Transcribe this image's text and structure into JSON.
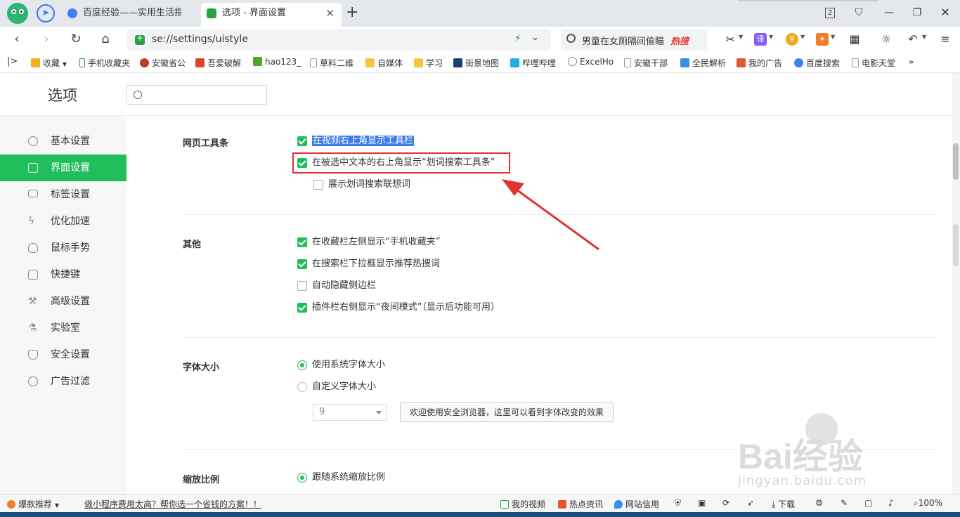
{
  "browser": {
    "tabs": [
      {
        "label": "百度经验——实用生活指南",
        "active": false
      },
      {
        "label": "选项 - 界面设置",
        "active": true
      }
    ],
    "window_count": "2",
    "address_url": "se://settings/uistyle",
    "search_text": "男童在女厕隔间偷瞄",
    "search_hot": "热搜"
  },
  "bookmarks": [
    "收藏",
    "手机收藏夹",
    "安徽省公",
    "吾爱破解",
    "hao123_",
    "草料二维",
    "自媒体",
    "学习",
    "街景地图",
    "哔哩哔哩",
    "ExcelHo",
    "安徽干部",
    "全民解析",
    "我的广告",
    "百度搜索",
    "电影天堂",
    "»"
  ],
  "page": {
    "title": "选项"
  },
  "sidebar": {
    "items": [
      {
        "label": "基本设置",
        "icon": "gear-icon"
      },
      {
        "label": "界面设置",
        "icon": "window-icon",
        "active": true
      },
      {
        "label": "标签设置",
        "icon": "tab-icon"
      },
      {
        "label": "优化加速",
        "icon": "bolt-icon"
      },
      {
        "label": "鼠标手势",
        "icon": "mouse-icon"
      },
      {
        "label": "快捷键",
        "icon": "keyboard-icon"
      },
      {
        "label": "高级设置",
        "icon": "wrench-icon"
      },
      {
        "label": "实验室",
        "icon": "flask-icon"
      },
      {
        "label": "安全设置",
        "icon": "shield-icon"
      },
      {
        "label": "广告过滤",
        "icon": "block-icon"
      }
    ]
  },
  "sections": {
    "toolbar": {
      "title": "网页工具条",
      "opt1": "在视频右上角显示工具栏",
      "opt2": "在被选中文本的右上角显示“划词搜索工具条”",
      "opt3": "展示划词搜索联想词"
    },
    "other": {
      "title": "其他",
      "opt1": "在收藏栏左侧显示“手机收藏夹”",
      "opt2": "在搜索栏下拉框显示推荐热搜词",
      "opt3": "自动隐藏侧边栏",
      "opt4": "插件栏右侧显示“夜间模式”（显示后功能可用）"
    },
    "font": {
      "title": "字体大小",
      "opt1": "使用系统字体大小",
      "opt2": "自定义字体大小",
      "size_value": "9",
      "preview": "欢迎使用安全浏览器，这里可以看到字体改变的效果"
    },
    "zoom": {
      "title": "缩放比例",
      "opt1": "跟随系统缩放比例"
    }
  },
  "watermark": {
    "brand": "Bai经验",
    "domain": "jingyan.baidu.com"
  },
  "statusbar": {
    "recommend": "爆款推荐",
    "ad": "做小程序费用太高？帮你选一个省钱的方案！！",
    "my_video": "我的视频",
    "news": "热点资讯",
    "credit": "网站信用",
    "download": "下载",
    "zoom": "100%"
  },
  "colors": {
    "accent": "#21bf5c",
    "highlight_box": "#e23131",
    "selection": "#3d7de8"
  }
}
